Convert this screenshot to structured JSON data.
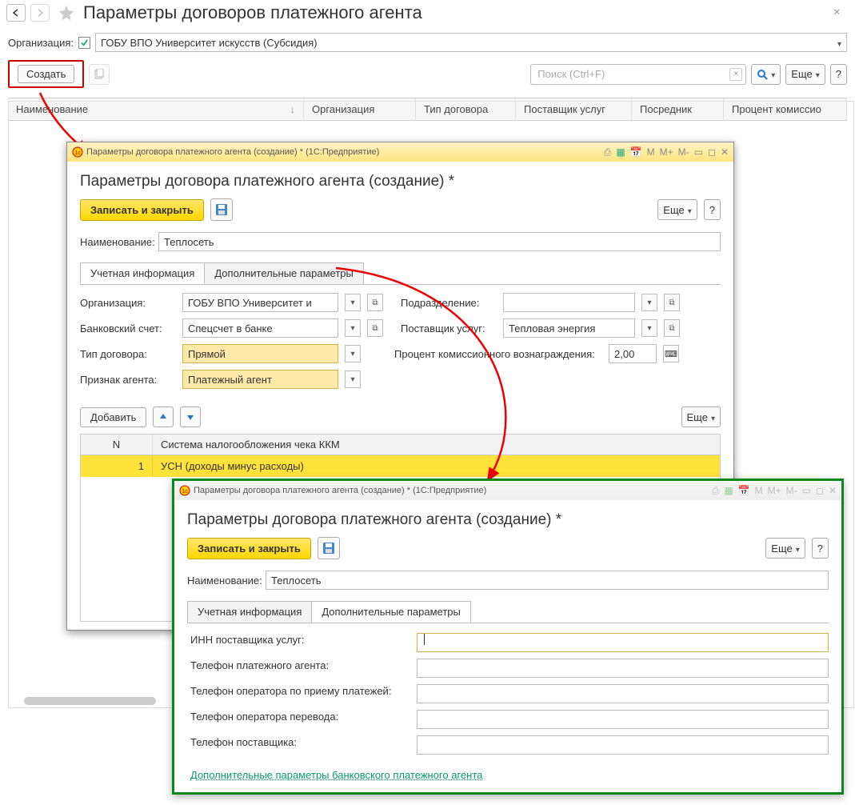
{
  "main": {
    "title": "Параметры договоров платежного агента",
    "org_label": "Организация:",
    "org_value": "ГОБУ ВПО Университет искусств (Субсидия)",
    "create_label": "Создать",
    "search_placeholder": "Поиск (Ctrl+F)",
    "more_label": "Еще",
    "columns": {
      "name": "Наименование",
      "org": "Организация",
      "type": "Тип договора",
      "provider": "Поставщик услуг",
      "middle": "Посредник",
      "commission": "Процент комиссио"
    }
  },
  "dialog1": {
    "titlebar": "Параметры договора платежного агента (создание) *  (1С:Предприятие)",
    "heading": "Параметры договора платежного агента (создание) *",
    "save_close": "Записать и закрыть",
    "more": "Еще",
    "name_label": "Наименование:",
    "name_value": "Теплосеть",
    "tab1": "Учетная информация",
    "tab2": "Дополнительные параметры",
    "org_label": "Организация:",
    "org_value": "ГОБУ ВПО Университет и",
    "unit_label": "Подразделение:",
    "unit_value": "",
    "bank_label": "Банковский счет:",
    "bank_value": "Спецсчет в банке",
    "provider_label": "Поставщик услуг:",
    "provider_value": "Тепловая энергия",
    "type_label": "Тип договора:",
    "type_value": "Прямой",
    "percent_label": "Процент комиссионного вознаграждения:",
    "percent_value": "2,00",
    "agent_label": "Признак агента:",
    "agent_value": "Платежный агент",
    "add_label": "Добавить",
    "sub_more": "Еще",
    "th_n": "N",
    "th_tax": "Система налогообложения чека ККМ",
    "row_n": "1",
    "row_tax": "УСН (доходы минус расходы)"
  },
  "dialog2": {
    "titlebar": "Параметры договора платежного агента (создание) *  (1С:Предприятие)",
    "heading": "Параметры договора платежного агента (создание) *",
    "save_close": "Записать и закрыть",
    "more": "Еще",
    "name_label": "Наименование:",
    "name_value": "Теплосеть",
    "tab1": "Учетная информация",
    "tab2": "Дополнительные параметры",
    "f_inn": "ИНН поставщика услуг:",
    "f_phone_agent": "Телефон платежного агента:",
    "f_phone_operator": "Телефон оператора по приему платежей:",
    "f_phone_transfer": "Телефон оператора перевода:",
    "f_phone_provider": "Телефон поставщика:",
    "link": "Дополнительные параметры банковского платежного агента"
  },
  "tb_icons": {
    "m": "M",
    "mp": "M+",
    "mm": "M-"
  }
}
